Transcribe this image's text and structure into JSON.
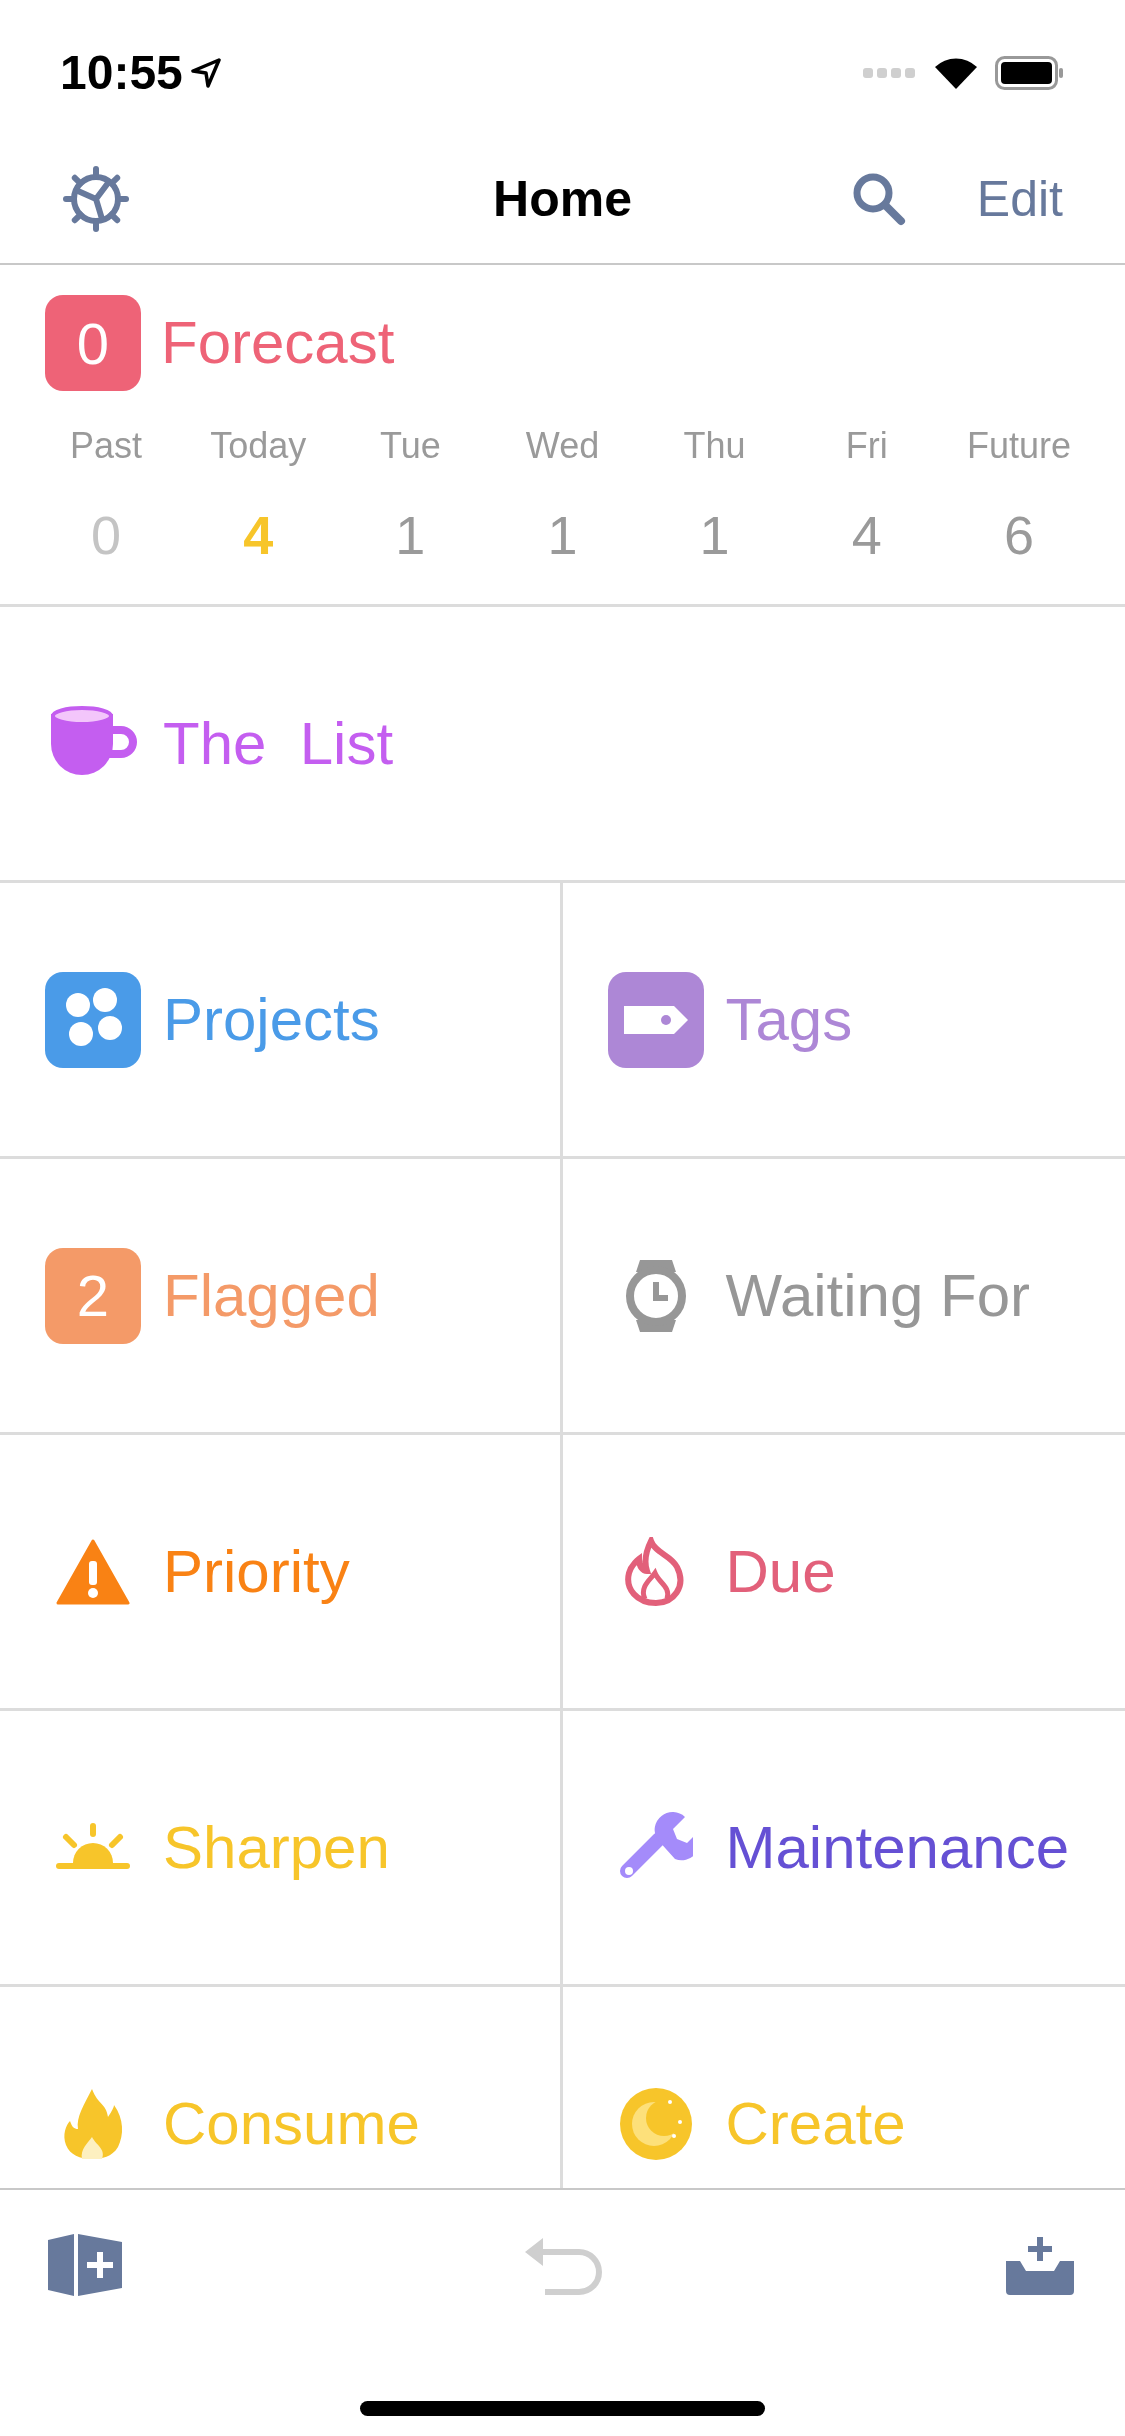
{
  "status_bar": {
    "time": "10:55"
  },
  "nav": {
    "title": "Home",
    "edit": "Edit"
  },
  "forecast": {
    "badge": "0",
    "label": "Forecast",
    "color": "#ee6377",
    "days": [
      {
        "label": "Past",
        "count": "0",
        "kind": "past"
      },
      {
        "label": "Today",
        "count": "4",
        "kind": "today"
      },
      {
        "label": "Tue",
        "count": "1",
        "kind": "day"
      },
      {
        "label": "Wed",
        "count": "1",
        "kind": "day"
      },
      {
        "label": "Thu",
        "count": "1",
        "kind": "day"
      },
      {
        "label": "Fri",
        "count": "4",
        "kind": "day"
      },
      {
        "label": "Future",
        "count": "6",
        "kind": "day"
      }
    ]
  },
  "featured": {
    "label": "The  List",
    "kind": "cup",
    "color": "#c45ef0"
  },
  "tiles": [
    {
      "label": "Projects",
      "kind": "projects",
      "color": "#4a9be8"
    },
    {
      "label": "Tags",
      "kind": "tags",
      "color": "#ad87d6"
    },
    {
      "label": "Flagged",
      "kind": "badge",
      "badge": "2",
      "color": "#f49a68"
    },
    {
      "label": "Waiting For",
      "kind": "watch",
      "color": "#979797"
    },
    {
      "label": "Priority",
      "kind": "warning",
      "color": "#f98214"
    },
    {
      "label": "Due",
      "kind": "flame",
      "color": "#e2607a"
    },
    {
      "label": "Sharpen",
      "kind": "sun",
      "color": "#f7c52a"
    },
    {
      "label": "Maintenance",
      "kind": "wrench",
      "color": "#6550d4"
    },
    {
      "label": "Consume",
      "kind": "fire",
      "color": "#f7c52a"
    },
    {
      "label": "Create",
      "kind": "moon",
      "color": "#f7c52a"
    }
  ],
  "toolbar": [
    {
      "kind": "perspective",
      "disabled": false
    },
    {
      "kind": "undo",
      "disabled": true
    },
    {
      "kind": "inbox",
      "disabled": false
    }
  ]
}
